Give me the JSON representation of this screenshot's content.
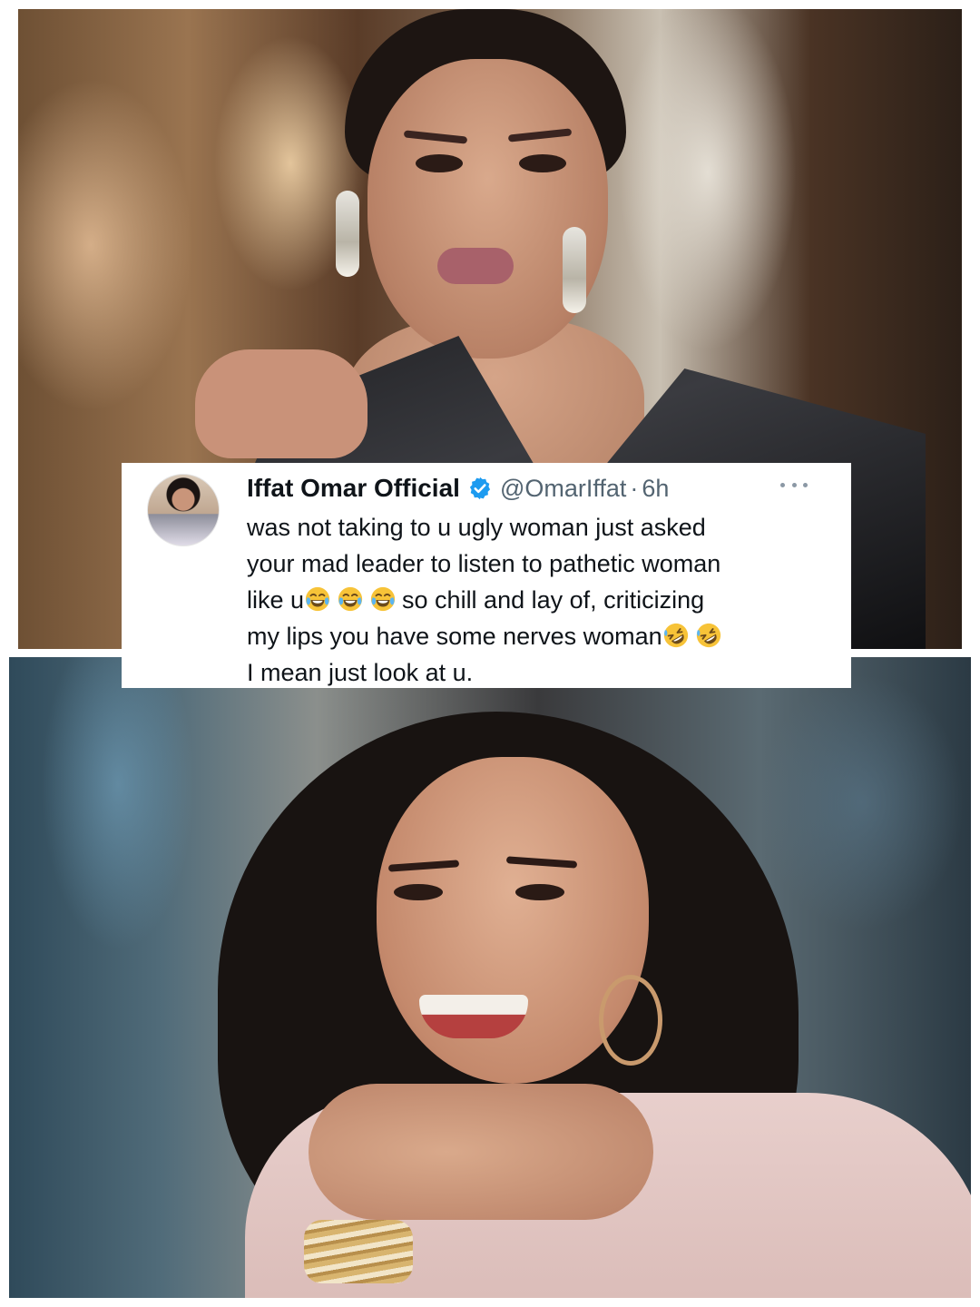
{
  "tweet": {
    "display_name": "Iffat Omar Official",
    "handle": "@OmarIffat",
    "separator": "·",
    "time": "6h",
    "text": {
      "line1": "was not taking to u ugly woman just asked",
      "line2": "your mad leader to listen to pathetic woman",
      "line3a": "like u",
      "line3b": "so chill and lay of, criticizing",
      "line4": "my lips you have some nerves woman",
      "line5": "I mean just look at u."
    },
    "emojis": {
      "line3": [
        "face-with-tears-of-joy",
        "face-with-tears-of-joy",
        "face-with-tears-of-joy"
      ],
      "line4": [
        "rolling-on-the-floor-laughing",
        "rolling-on-the-floor-laughing"
      ]
    }
  },
  "icons": {
    "verified": "verified-badge-icon",
    "more": "more-options-icon"
  },
  "colors": {
    "text_primary": "#0f1419",
    "text_secondary": "#536471",
    "verified_blue": "#1d9bf0",
    "emoji_yellow": "#f7c338"
  }
}
